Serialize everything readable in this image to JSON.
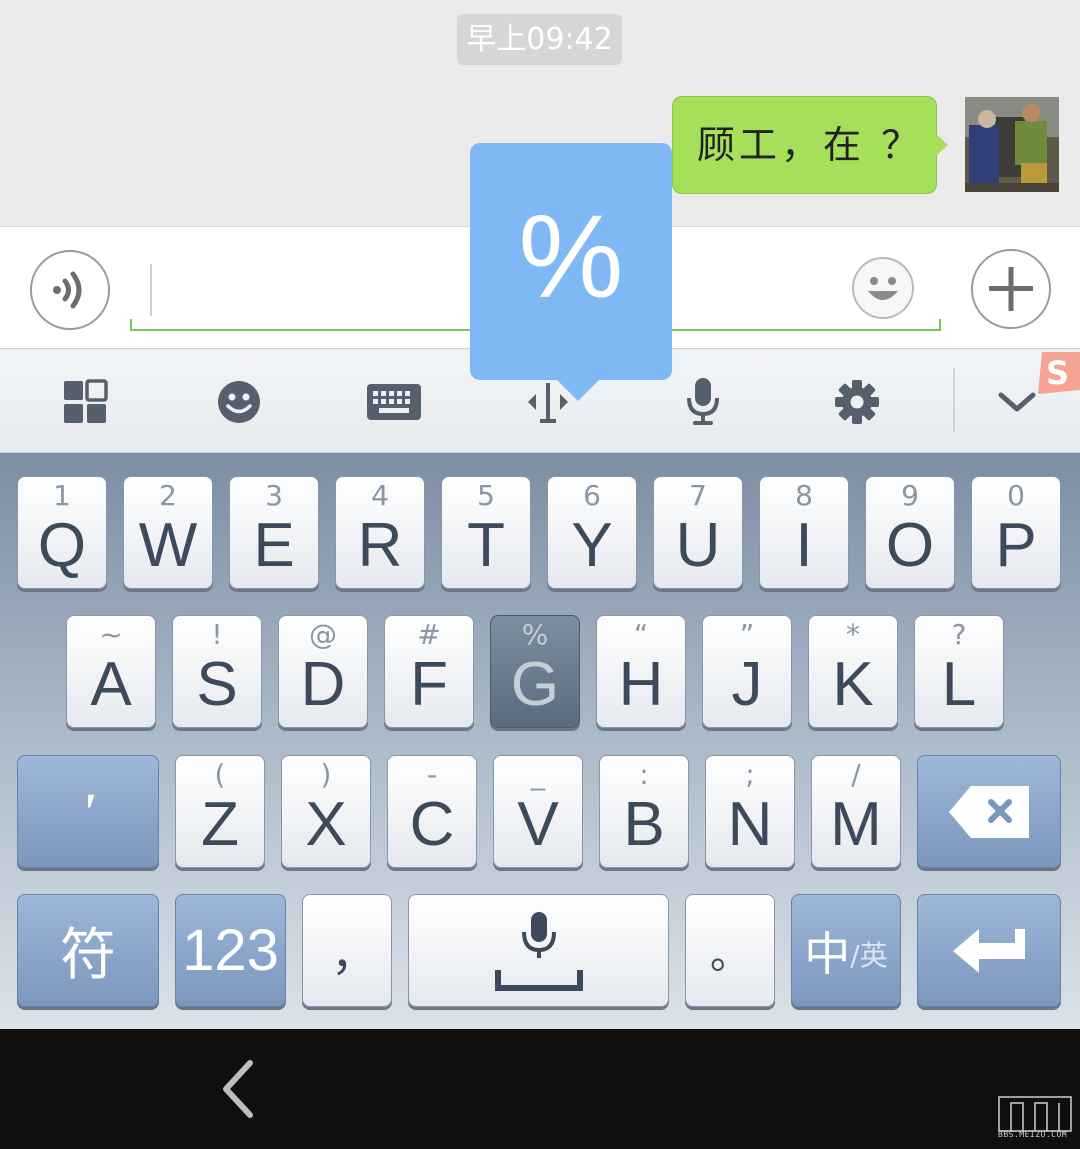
{
  "chat": {
    "timestamp": "早上09:42",
    "messages": [
      {
        "from": "me",
        "text": "顾工，在 ？"
      }
    ]
  },
  "input_bar": {
    "voice_icon": "voice-input-icon",
    "emoji_icon": "smiley-icon",
    "more_icon": "plus-icon",
    "accent_color": "#7cc55b"
  },
  "popup": {
    "char": "%"
  },
  "ime_toolbar": {
    "items": [
      {
        "name": "menu-grid-icon"
      },
      {
        "name": "emoji-icon"
      },
      {
        "name": "keyboard-icon"
      },
      {
        "name": "cursor-move-icon"
      },
      {
        "name": "microphone-icon"
      },
      {
        "name": "settings-gear-icon"
      },
      {
        "name": "collapse-chevron-icon"
      }
    ],
    "brand_mark": "S"
  },
  "keyboard": {
    "row1": [
      {
        "sub": "1",
        "main": "Q"
      },
      {
        "sub": "2",
        "main": "W"
      },
      {
        "sub": "3",
        "main": "E"
      },
      {
        "sub": "4",
        "main": "R"
      },
      {
        "sub": "5",
        "main": "T"
      },
      {
        "sub": "6",
        "main": "Y"
      },
      {
        "sub": "7",
        "main": "U"
      },
      {
        "sub": "8",
        "main": "I"
      },
      {
        "sub": "9",
        "main": "O"
      },
      {
        "sub": "0",
        "main": "P"
      }
    ],
    "row2": [
      {
        "sub": "~",
        "main": "A"
      },
      {
        "sub": "!",
        "main": "S"
      },
      {
        "sub": "@",
        "main": "D"
      },
      {
        "sub": "#",
        "main": "F"
      },
      {
        "sub": "%",
        "main": "G",
        "pressed": true
      },
      {
        "sub": "“",
        "main": "H"
      },
      {
        "sub": "”",
        "main": "J"
      },
      {
        "sub": "*",
        "main": "K"
      },
      {
        "sub": "?",
        "main": "L"
      }
    ],
    "row3": [
      {
        "sub": "(",
        "main": "Z"
      },
      {
        "sub": ")",
        "main": "X"
      },
      {
        "sub": "-",
        "main": "C"
      },
      {
        "sub": "_",
        "main": "V"
      },
      {
        "sub": ":",
        "main": "B"
      },
      {
        "sub": ";",
        "main": "N"
      },
      {
        "sub": "/",
        "main": "M"
      }
    ],
    "apostrophe": "'",
    "symbols": "符",
    "numbers": "123",
    "comma": "，",
    "period": "。",
    "lang_main": "中",
    "lang_sub": "/英",
    "key_color": "#ffffff",
    "func_key_color": "#8aa6cc",
    "pressed_key_color": "#6b7b8f"
  },
  "nav": {
    "back_icon": "back-chevron-icon",
    "watermark": "BBS.MEIZU.COM"
  }
}
